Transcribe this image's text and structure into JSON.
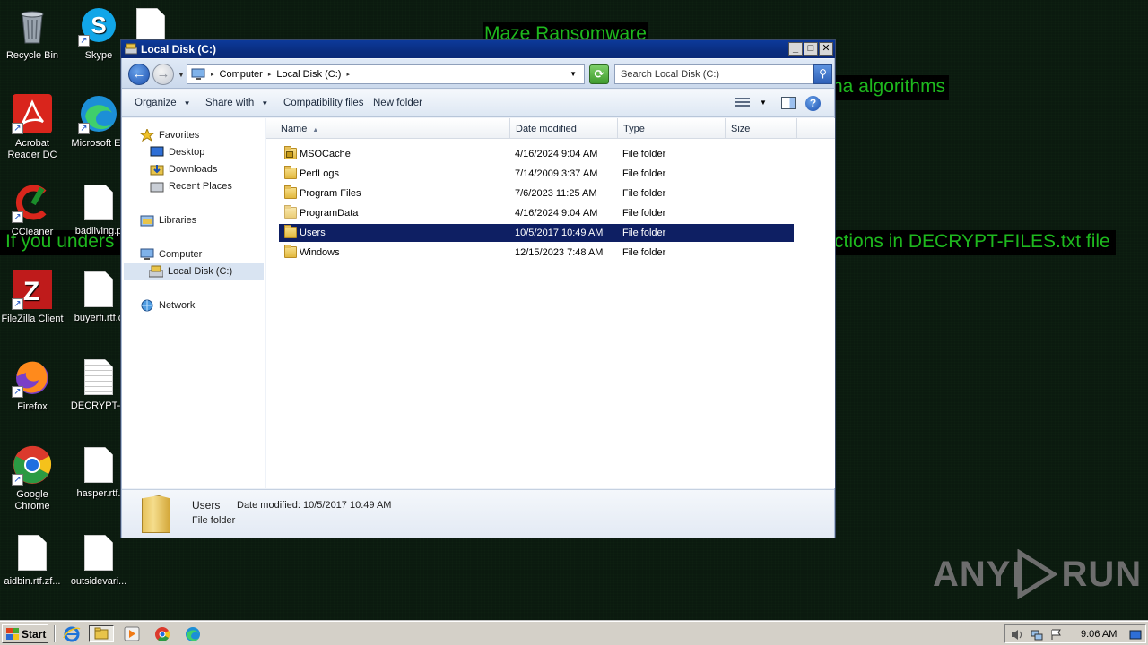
{
  "wallpaper": {
    "title": "Maze Ransomware",
    "line1_right": "ha algorithms",
    "line2_left": "If you unders",
    "line2_right": "ctions in DECRYPT-FILES.txt file"
  },
  "desktop_icons": [
    {
      "label": "Recycle Bin"
    },
    {
      "label": "Skype"
    },
    {
      "label": "Acrobat Reader DC"
    },
    {
      "label": "Microsoft Ed"
    },
    {
      "label": "CCleaner"
    },
    {
      "label": "badliving.p"
    },
    {
      "label": "FileZilla Client"
    },
    {
      "label": "buyerfi.rtf.c"
    },
    {
      "label": "Firefox"
    },
    {
      "label": "DECRYPT-F"
    },
    {
      "label": "Google Chrome"
    },
    {
      "label": "hasper.rtf."
    },
    {
      "label": "aidbin.rtf.zf..."
    },
    {
      "label": "outsidevari..."
    }
  ],
  "window": {
    "title": "Local Disk (C:)",
    "controls": {
      "minimize": "_",
      "maximize": "□",
      "close": "✕"
    },
    "address": {
      "crumbs": [
        "Computer",
        "Local Disk (C:)"
      ]
    },
    "search": {
      "placeholder": "Search Local Disk (C:)"
    },
    "toolbar": {
      "organize": "Organize",
      "share_with": "Share with",
      "compatibility_files": "Compatibility files",
      "new_folder": "New folder"
    },
    "nav": {
      "favorites": "Favorites",
      "desktop": "Desktop",
      "downloads": "Downloads",
      "recent_places": "Recent Places",
      "libraries": "Libraries",
      "computer": "Computer",
      "local_disk": "Local Disk (C:)",
      "network": "Network"
    },
    "columns": {
      "name": "Name",
      "date_modified": "Date modified",
      "type": "Type",
      "size": "Size"
    },
    "files": [
      {
        "name": "MSOCache",
        "date": "4/16/2024 9:04 AM",
        "type": "File folder"
      },
      {
        "name": "PerfLogs",
        "date": "7/14/2009 3:37 AM",
        "type": "File folder"
      },
      {
        "name": "Program Files",
        "date": "7/6/2023 11:25 AM",
        "type": "File folder"
      },
      {
        "name": "ProgramData",
        "date": "4/16/2024 9:04 AM",
        "type": "File folder"
      },
      {
        "name": "Users",
        "date": "10/5/2017 10:49 AM",
        "type": "File folder"
      },
      {
        "name": "Windows",
        "date": "12/15/2023 7:48 AM",
        "type": "File folder"
      }
    ],
    "selected_index": 4,
    "details": {
      "name": "Users",
      "date_modified": "Date modified: 10/5/2017 10:49 AM",
      "type": "File folder"
    }
  },
  "watermark": {
    "left": "ANY",
    "right": "RUN"
  },
  "taskbar": {
    "start_label": "Start",
    "clock": "9:06 AM"
  },
  "colors": {
    "wallpaper_text": "#1eb81e",
    "selection": "#0e1f63",
    "titlebar": "#0a2d80"
  }
}
